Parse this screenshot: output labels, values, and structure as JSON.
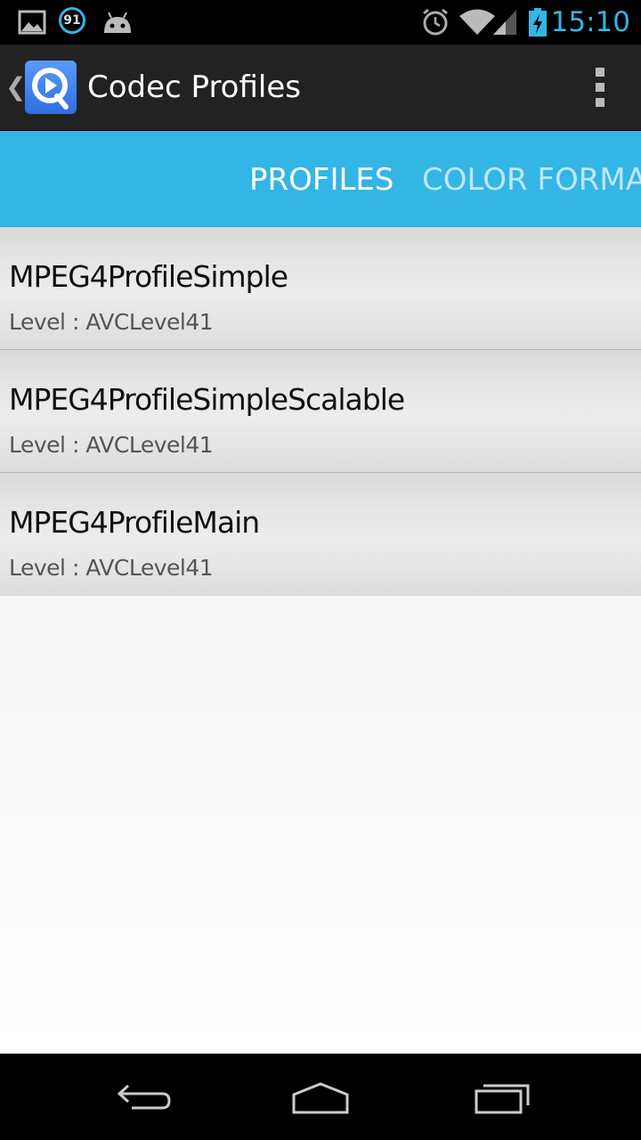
{
  "status_bar": {
    "time": "15:10",
    "notification_count": "91",
    "icons": [
      "gallery-icon",
      "notification-count-icon",
      "android-icon",
      "alarm-icon",
      "wifi-icon",
      "signal-icon",
      "battery-charging-icon"
    ]
  },
  "action_bar": {
    "title": "Codec Profiles"
  },
  "tabs": [
    {
      "label": "PROFILES",
      "selected": true
    },
    {
      "label": "COLOR FORMATS",
      "selected": false
    }
  ],
  "profiles": [
    {
      "name": "MPEG4ProfileSimple",
      "level": "Level : AVCLevel41"
    },
    {
      "name": "MPEG4ProfileSimpleScalable",
      "level": "Level : AVCLevel41"
    },
    {
      "name": "MPEG4ProfileMain",
      "level": "Level : AVCLevel41"
    }
  ],
  "colors": {
    "accent": "#33b5e5",
    "action_bar": "#222222",
    "app_icon": "#4286f4"
  }
}
